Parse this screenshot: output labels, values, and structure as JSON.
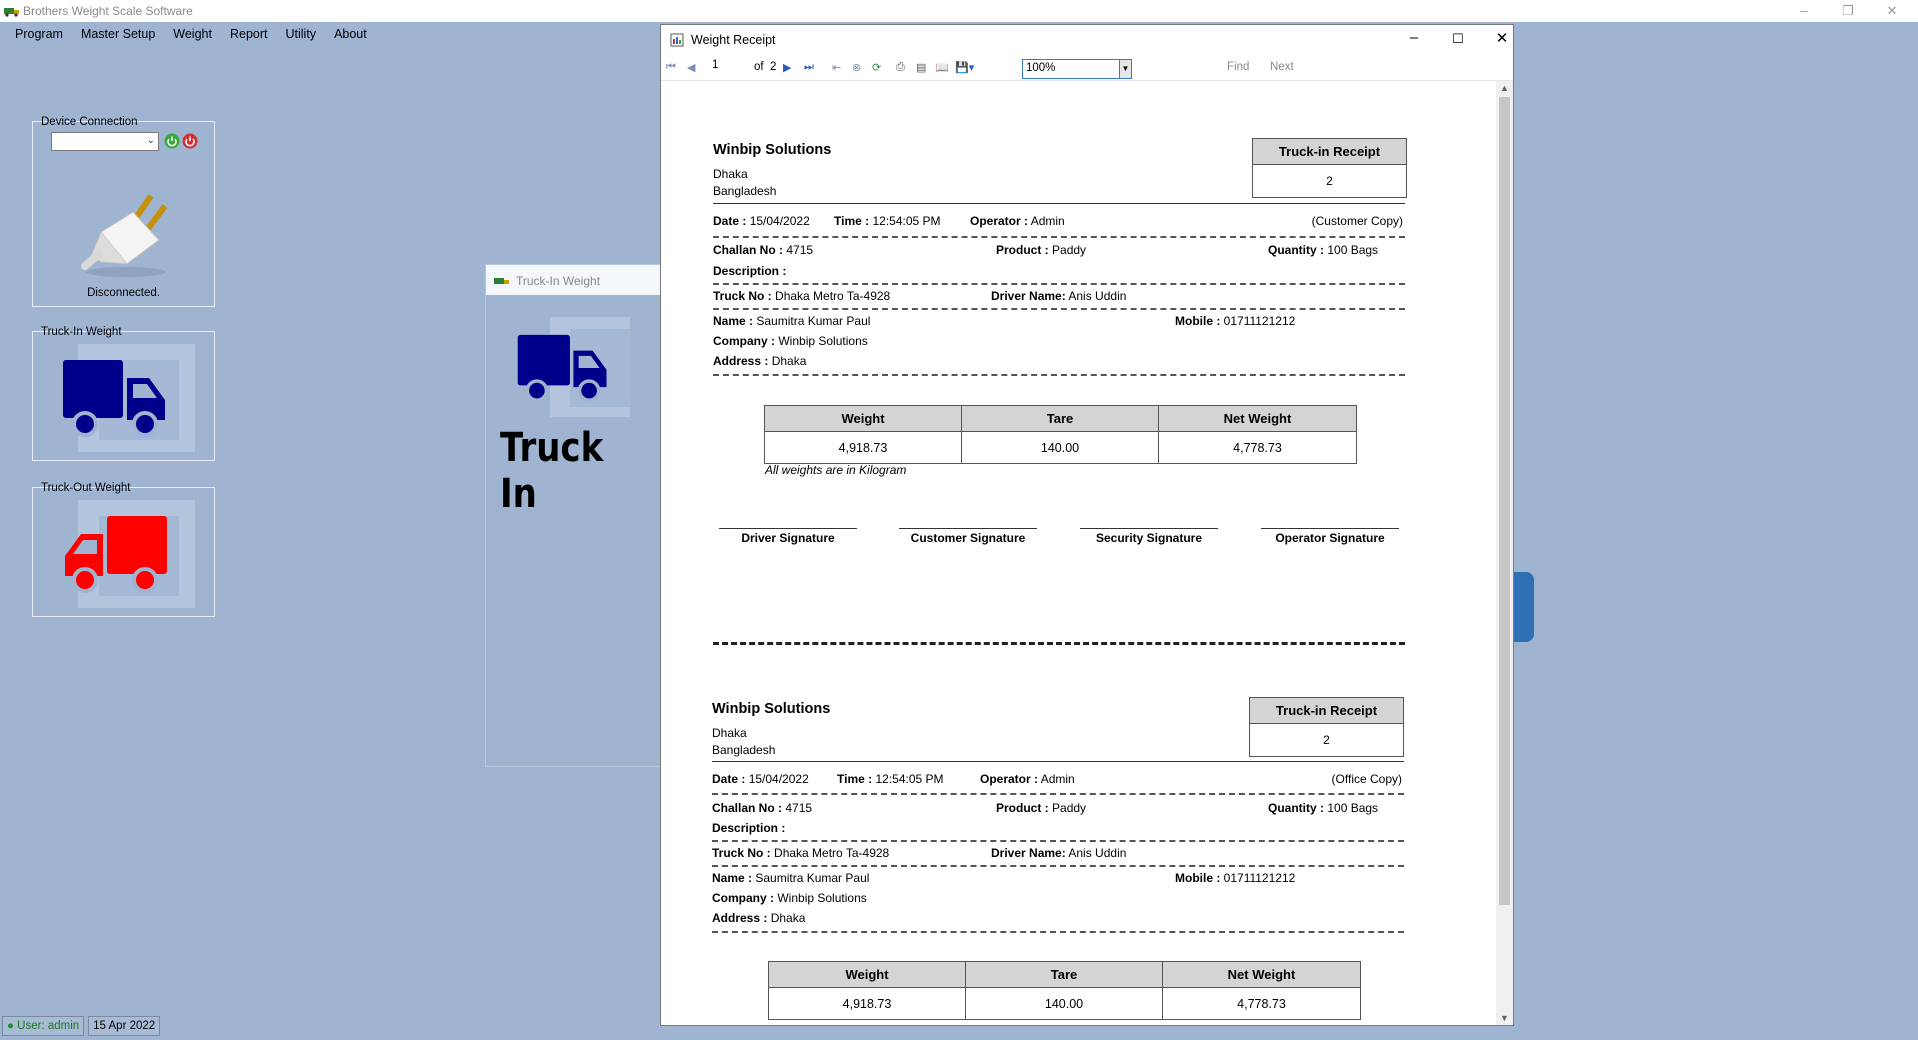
{
  "app": {
    "title": "Brothers Weight Scale Software"
  },
  "menu": [
    "Program",
    "Master Setup",
    "Weight",
    "Report",
    "Utility",
    "About"
  ],
  "device_panel": {
    "title": "Device Connection",
    "selected": "",
    "status": "Disconnected.",
    "icons": [
      "power-on-icon",
      "power-off-icon",
      "plug-icon"
    ]
  },
  "truckin_panel": {
    "title": "Truck-In Weight",
    "icon": "blue-truck-icon",
    "color": "#00008b"
  },
  "truckout_panel": {
    "title": "Truck-Out Weight",
    "icon": "red-truck-icon",
    "color": "#ff0000"
  },
  "truckin_window": {
    "title": "Truck-In Weight",
    "big_line1": "Truck",
    "big_line2": "In"
  },
  "receipt_window": {
    "title": "Weight Receipt",
    "toolbar": {
      "page": "1",
      "of_label": "of",
      "total_pages": "2",
      "zoom": "100%",
      "find": "Find",
      "next": "Next"
    }
  },
  "receipts": [
    {
      "company": "Winbip Solutions",
      "city": "Dhaka",
      "country": "Bangladesh",
      "receipt_title": "Truck-in Receipt",
      "receipt_no": "2",
      "date_label": "Date :",
      "date": "15/04/2022",
      "time_label": "Time :",
      "time": "12:54:05 PM",
      "operator_label": "Operator :",
      "operator": "Admin",
      "copy": "(Customer Copy)",
      "challan_label": "Challan No :",
      "challan": "4715",
      "product_label": "Product :",
      "product": "Paddy",
      "quantity_label": "Quantity :",
      "quantity": "100 Bags",
      "description_label": "Description :",
      "truck_label": "Truck No :",
      "truck": "Dhaka Metro Ta-4928",
      "driver_label": "Driver Name:",
      "driver": "Anis Uddin",
      "name_label": "Name :",
      "name": "Saumitra Kumar Paul",
      "mobile_label": "Mobile :",
      "mobile": "01711121212",
      "company_label": "Company :",
      "company_value": "Winbip Solutions",
      "address_label": "Address :",
      "address": "Dhaka",
      "weights": {
        "headers": [
          "Weight",
          "Tare",
          "Net Weight"
        ],
        "values": [
          "4,918.73",
          "140.00",
          "4,778.73"
        ]
      },
      "note": "All weights are in Kilogram",
      "signatures": [
        "Driver Signature",
        "Customer Signature",
        "Security Signature",
        "Operator Signature"
      ]
    },
    {
      "company": "Winbip Solutions",
      "city": "Dhaka",
      "country": "Bangladesh",
      "receipt_title": "Truck-in Receipt",
      "receipt_no": "2",
      "date_label": "Date :",
      "date": "15/04/2022",
      "time_label": "Time :",
      "time": "12:54:05 PM",
      "operator_label": "Operator :",
      "operator": "Admin",
      "copy": "(Office Copy)",
      "challan_label": "Challan No :",
      "challan": "4715",
      "product_label": "Product :",
      "product": "Paddy",
      "quantity_label": "Quantity :",
      "quantity": "100 Bags",
      "description_label": "Description :",
      "truck_label": "Truck No :",
      "truck": "Dhaka Metro Ta-4928",
      "driver_label": "Driver Name:",
      "driver": "Anis Uddin",
      "name_label": "Name :",
      "name": "Saumitra Kumar Paul",
      "mobile_label": "Mobile :",
      "mobile": "01711121212",
      "company_label": "Company :",
      "company_value": "Winbip Solutions",
      "address_label": "Address :",
      "address": "Dhaka",
      "weights": {
        "headers": [
          "Weight",
          "Tare",
          "Net Weight"
        ],
        "values": [
          "4,918.73",
          "140.00",
          "4,778.73"
        ]
      }
    }
  ],
  "statusbar": {
    "user": "User: admin",
    "date": "15 Apr 2022"
  }
}
